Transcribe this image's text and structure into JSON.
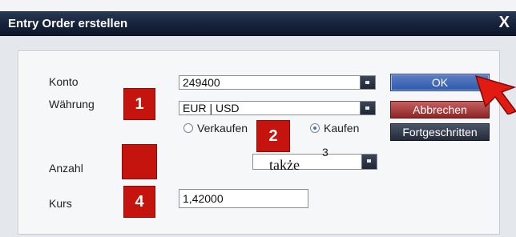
{
  "window": {
    "title": "Entry Order erstellen",
    "close_glyph": "X"
  },
  "form": {
    "konto_label": "Konto",
    "konto_value": "249400",
    "waehrung_label": "Währung",
    "waehrung_value": "EUR | USD",
    "verkaufen_label": "Verkaufen",
    "kaufen_label": "Kaufen",
    "kaufen_checked": true,
    "anzahl_label": "Anzahl",
    "kurs_label": "Kurs",
    "kurs_value": "1,42000"
  },
  "buttons": {
    "ok_label": "OK",
    "cancel_label": "Abbrechen",
    "advanced_label": "Fortgeschritten"
  },
  "markers": {
    "m1": "1",
    "m2": "2",
    "m3": "",
    "m4": "4"
  },
  "overlay": {
    "text": "także",
    "superscript": "3"
  },
  "colors": {
    "marker_red": "#c4140d",
    "ok_blue": "#2f59ad",
    "cancel_red": "#8f2525",
    "titlebar_navy": "#16223a"
  },
  "icons": {
    "close": "close-icon",
    "pointer": "red-arrow-icon",
    "dropdown": "chevron-down-icon"
  }
}
